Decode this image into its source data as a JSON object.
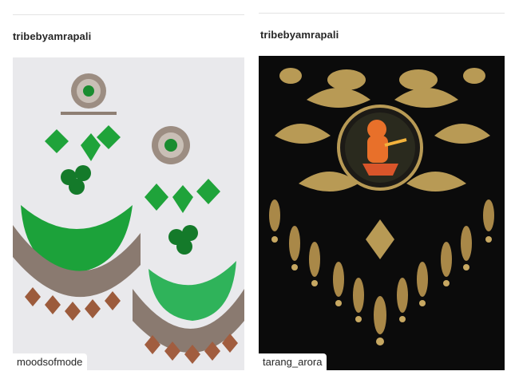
{
  "posts": [
    {
      "username": "tribebyamrapali",
      "tag": "moodsofmode",
      "image": "green-glass-silver-chandbali-earrings",
      "colors": {
        "background": "#ececef",
        "glass": "#1fa33a",
        "metal": "#8a7a70"
      }
    },
    {
      "username": "tribebyamrapali",
      "tag": "tarang_arora",
      "image": "gold-peacock-necklace-with-painted-ganesha-pendant",
      "colors": {
        "background": "#0b0b0b",
        "gold": "#b89a55",
        "pendant": "#e8702a"
      }
    }
  ]
}
